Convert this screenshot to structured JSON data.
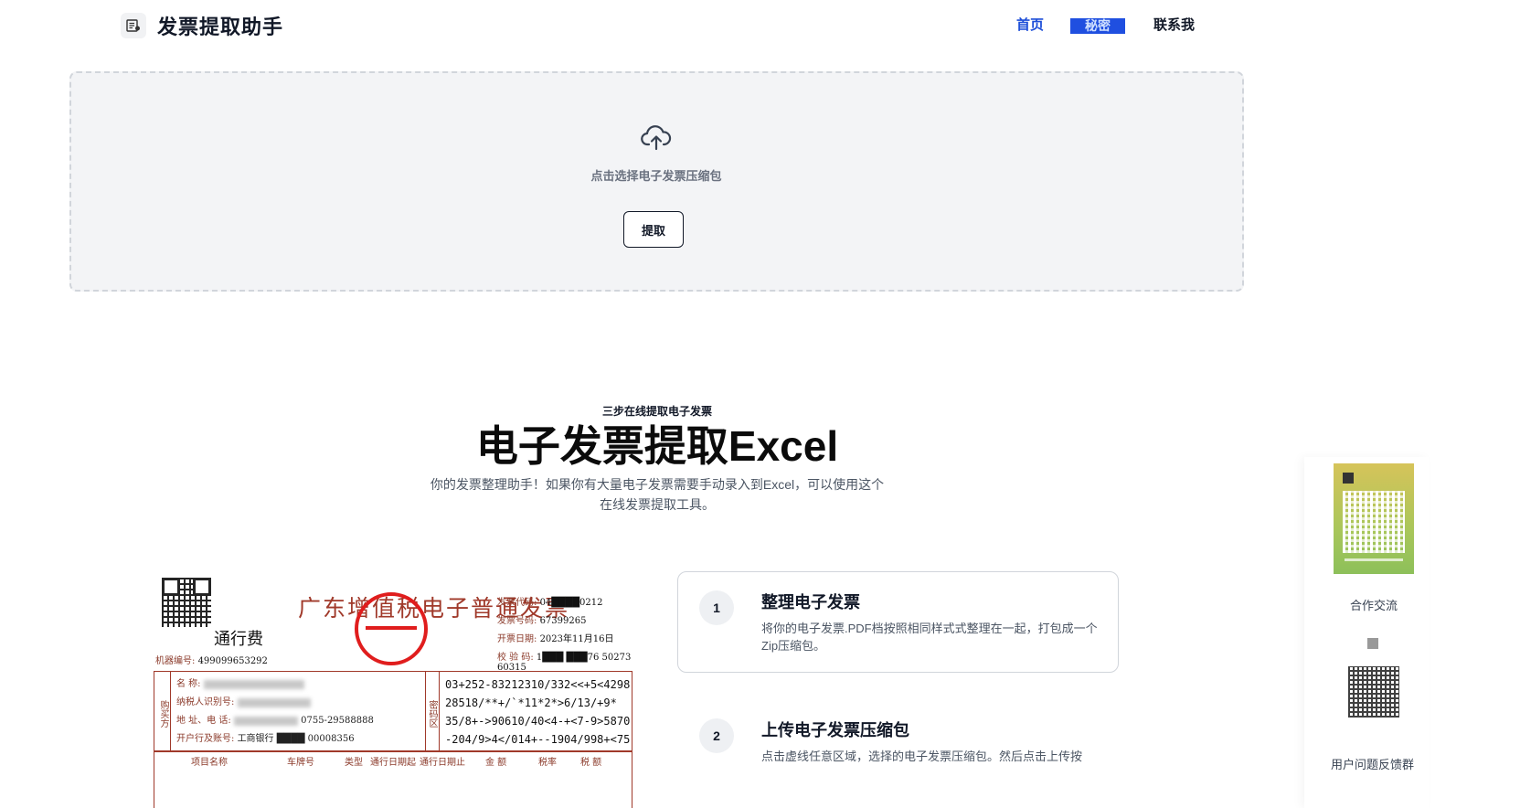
{
  "header": {
    "app_title": "发票提取助手",
    "logo_icon": "invoice-icon",
    "nav": {
      "home": "首页",
      "secret": "秘密",
      "contact": "联系我"
    }
  },
  "upload": {
    "icon": "cloud-upload-icon",
    "prompt": "点击选择电子发票压缩包",
    "button_label": "提取"
  },
  "hero": {
    "eyebrow": "三步在线提取电子发票",
    "title": "电子发票提取Excel",
    "description": "你的发票整理助手！如果你有大量电子发票需要手动录入到Excel，可以使用这个在线发票提取工具。"
  },
  "invoice_image": {
    "type_label": "通行费",
    "machine_label": "机器编号:",
    "machine_no": "499099653292",
    "title": "广东增值税电子普通发票",
    "meta": [
      {
        "label": "发票代码:",
        "value": "04████0212"
      },
      {
        "label": "发票号码:",
        "value": "67399265"
      },
      {
        "label": "开票日期:",
        "value": "2023年11月16日"
      },
      {
        "label": "校 验 码:",
        "value": "1███ ███76 50273 60315"
      }
    ],
    "buyer_label": "购买方",
    "buyer_rows": [
      {
        "label": "名      称:",
        "value": ""
      },
      {
        "label": "纳税人识别号:",
        "value": ""
      },
      {
        "label": "地 址、电 话:",
        "value": "0755-29588888"
      },
      {
        "label": "开户行及账号:",
        "value": "工商银行 ████ 00008356"
      }
    ],
    "cipher_label": "密码区",
    "cipher_lines": [
      "03+252-83212310/332<<+5<4298",
      "28518/**+/`*11*2*>6/13/+9*",
      "35/8+->90610/40<4-+<7-9>5870",
      "-204/9>4</014+--1904/998+<75"
    ],
    "columns": [
      "项目名称",
      "车牌号",
      "类型",
      "通行日期起",
      "通行日期止",
      "金 额",
      "税率",
      "税 额"
    ]
  },
  "steps": [
    {
      "number": "1",
      "title": "整理电子发票",
      "description": "将你的电子发票.PDF档按照相同样式式整理在一起，打包成一个Zip压缩包。"
    },
    {
      "number": "2",
      "title": "上传电子发票压缩包",
      "description": "点击虚线任意区域，选择的电子发票压缩包。然后点击上传按"
    }
  ],
  "sidebar": {
    "cooperation_label": "合作交流",
    "bottom_text": "用户问题反馈群"
  },
  "colors": {
    "nav_active": "#1d4ed8",
    "secret_bg": "#1f4fe0",
    "stamp_red": "#e01d1d",
    "invoice_brown": "#a0392a"
  }
}
